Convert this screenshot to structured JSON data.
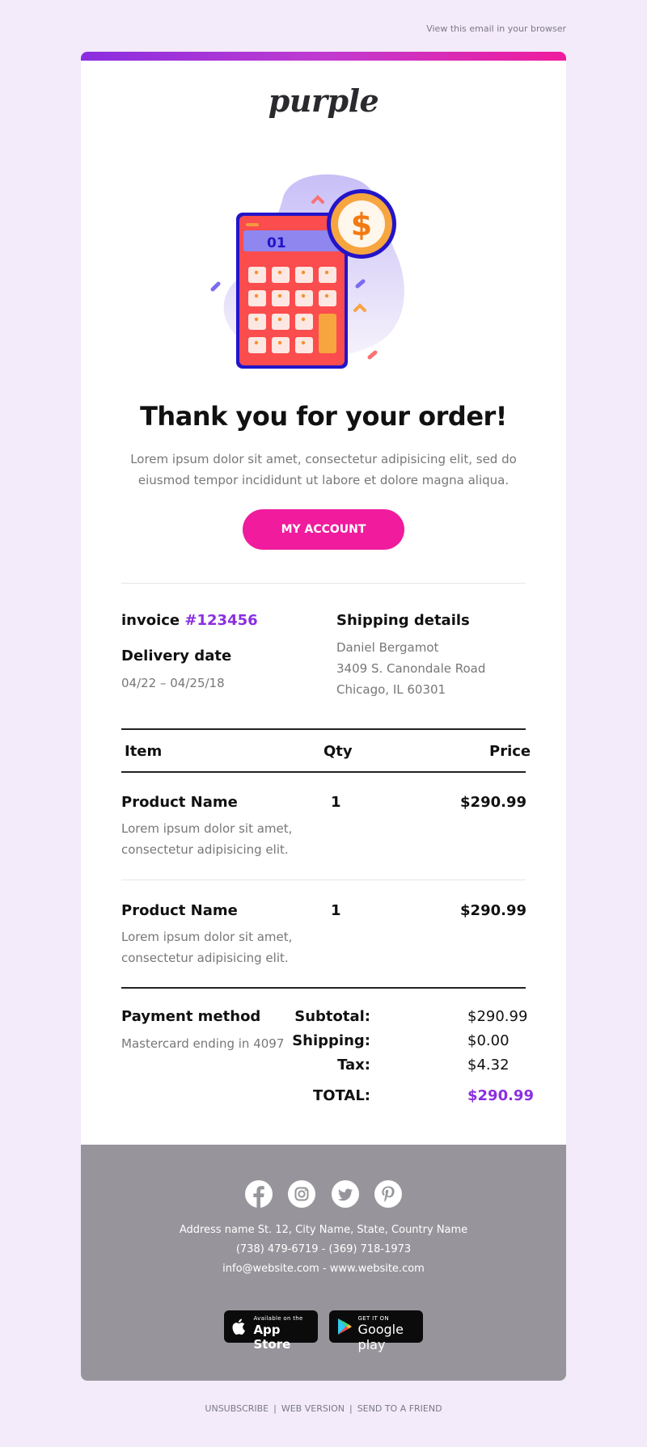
{
  "header": {
    "view_in_browser": "View this email in your browser"
  },
  "brand": {
    "logo": "purple",
    "accent": "#8b2fe0",
    "pink": "#f01b9d"
  },
  "hero": {
    "calculator_display": "01",
    "coin_symbol": "$"
  },
  "hero_text": {
    "title": "Thank you for your order!",
    "intro": "Lorem ipsum dolor sit amet, consectetur adipisicing elit, sed do eiusmod tempor incididunt ut labore et dolore magna aliqua."
  },
  "cta": {
    "label": "MY ACCOUNT"
  },
  "order": {
    "invoice_label": "invoice",
    "invoice_number": "#123456",
    "delivery_label": "Delivery date",
    "delivery_date": "04/22 – 04/25/18",
    "shipping_label": "Shipping details",
    "shipping_name": "Daniel Bergamot",
    "shipping_street": "3409 S. Canondale Road",
    "shipping_city": "Chicago, IL 60301"
  },
  "table": {
    "headers": {
      "item": "Item",
      "qty": "Qty",
      "price": "Price"
    },
    "items": [
      {
        "name": "Product Name",
        "desc": "Lorem ipsum dolor sit amet, consectetur adipisicing elit.",
        "qty": "1",
        "price": "$290.99"
      },
      {
        "name": "Product Name",
        "desc": "Lorem ipsum dolor sit amet, consectetur adipisicing elit.",
        "qty": "1",
        "price": "$290.99"
      }
    ]
  },
  "payment": {
    "label": "Payment method",
    "value": "Mastercard ending in 4097"
  },
  "totals": {
    "subtotal_label": "Subtotal:",
    "subtotal": "$290.99",
    "shipping_label": "Shipping:",
    "shipping": "$0.00",
    "tax_label": "Tax:",
    "tax": "$4.32",
    "total_label": "TOTAL:",
    "total": "$290.99"
  },
  "footer": {
    "socials": [
      "facebook-icon",
      "instagram-icon",
      "twitter-icon",
      "pinterest-icon"
    ],
    "address": "Address name St. 12, City Name, State, Country Name",
    "phones": "(738) 479-6719 - (369) 718-1973",
    "contact": "info@website.com - www.website.com",
    "appstore_small": "Available on the",
    "appstore_big": "App Store",
    "googleplay_small": "GET IT ON",
    "googleplay_big": "Google play"
  },
  "bottom": {
    "unsubscribe": "UNSUBSCRIBE",
    "web_version": "WEB VERSION",
    "send_friend": "SEND TO A FRIEND"
  }
}
